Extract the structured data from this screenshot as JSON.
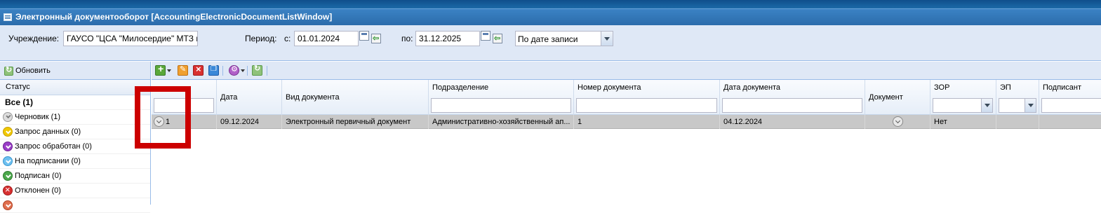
{
  "window": {
    "title": "Электронный документооборот [AccountingElectronicDocumentListWindow]"
  },
  "filters": {
    "institution_label": "Учреждение:",
    "institution_value": "ГАУСО \"ЦСА \"Милосердие\" МТЗ и",
    "period_label": "Период:",
    "from_label": "с:",
    "from_value": "01.01.2024",
    "to_label": "по:",
    "to_value": "31.12.2025",
    "date_mode_value": "По дате записи"
  },
  "left_panel": {
    "refresh_label": "Обновить",
    "status_header": "Статус",
    "statuses": [
      {
        "label": "Все (1)",
        "icon": "none"
      },
      {
        "label": "Черновик (1)",
        "icon": "grey-check-icon",
        "color": "#dddddd"
      },
      {
        "label": "Запрос данных (0)",
        "icon": "yellow-check-icon",
        "color": "#f0c800"
      },
      {
        "label": "Запрос обработан (0)",
        "icon": "purple-check-icon",
        "color": "#9b3fc8"
      },
      {
        "label": "На подписании (0)",
        "icon": "blue-check-icon",
        "color": "#6ec0f0"
      },
      {
        "label": "Подписан (0)",
        "icon": "green-check-icon",
        "color": "#4ca84c"
      },
      {
        "label": "Отклонен (0)",
        "icon": "red-cross-icon",
        "color": "#d83030"
      },
      {
        "label": "",
        "icon": "orange-icon",
        "color": "#e07050"
      }
    ]
  },
  "grid": {
    "columns": [
      {
        "label": "",
        "filter": "text"
      },
      {
        "label": "Дата",
        "filter": "none"
      },
      {
        "label": "Вид документа",
        "filter": "none"
      },
      {
        "label": "Подразделение",
        "filter": "text"
      },
      {
        "label": "Номер документа",
        "filter": "text"
      },
      {
        "label": "Дата документа",
        "filter": "text"
      },
      {
        "label": "Документ",
        "filter": "none"
      },
      {
        "label": "ЗОР",
        "filter": "combo"
      },
      {
        "label": "ЭП",
        "filter": "combo"
      },
      {
        "label": "Подписант",
        "filter": "text"
      }
    ],
    "rows": [
      {
        "num": "1",
        "date": "09.12.2024",
        "doc_type": "Электронный первичный документ",
        "department": "Административно-хозяйственный ап...",
        "doc_number": "1",
        "doc_date": "04.12.2024",
        "document": "",
        "zor": "Нет",
        "ep": "",
        "signer": ""
      }
    ]
  },
  "annotation": {
    "color": "#cc0000"
  }
}
